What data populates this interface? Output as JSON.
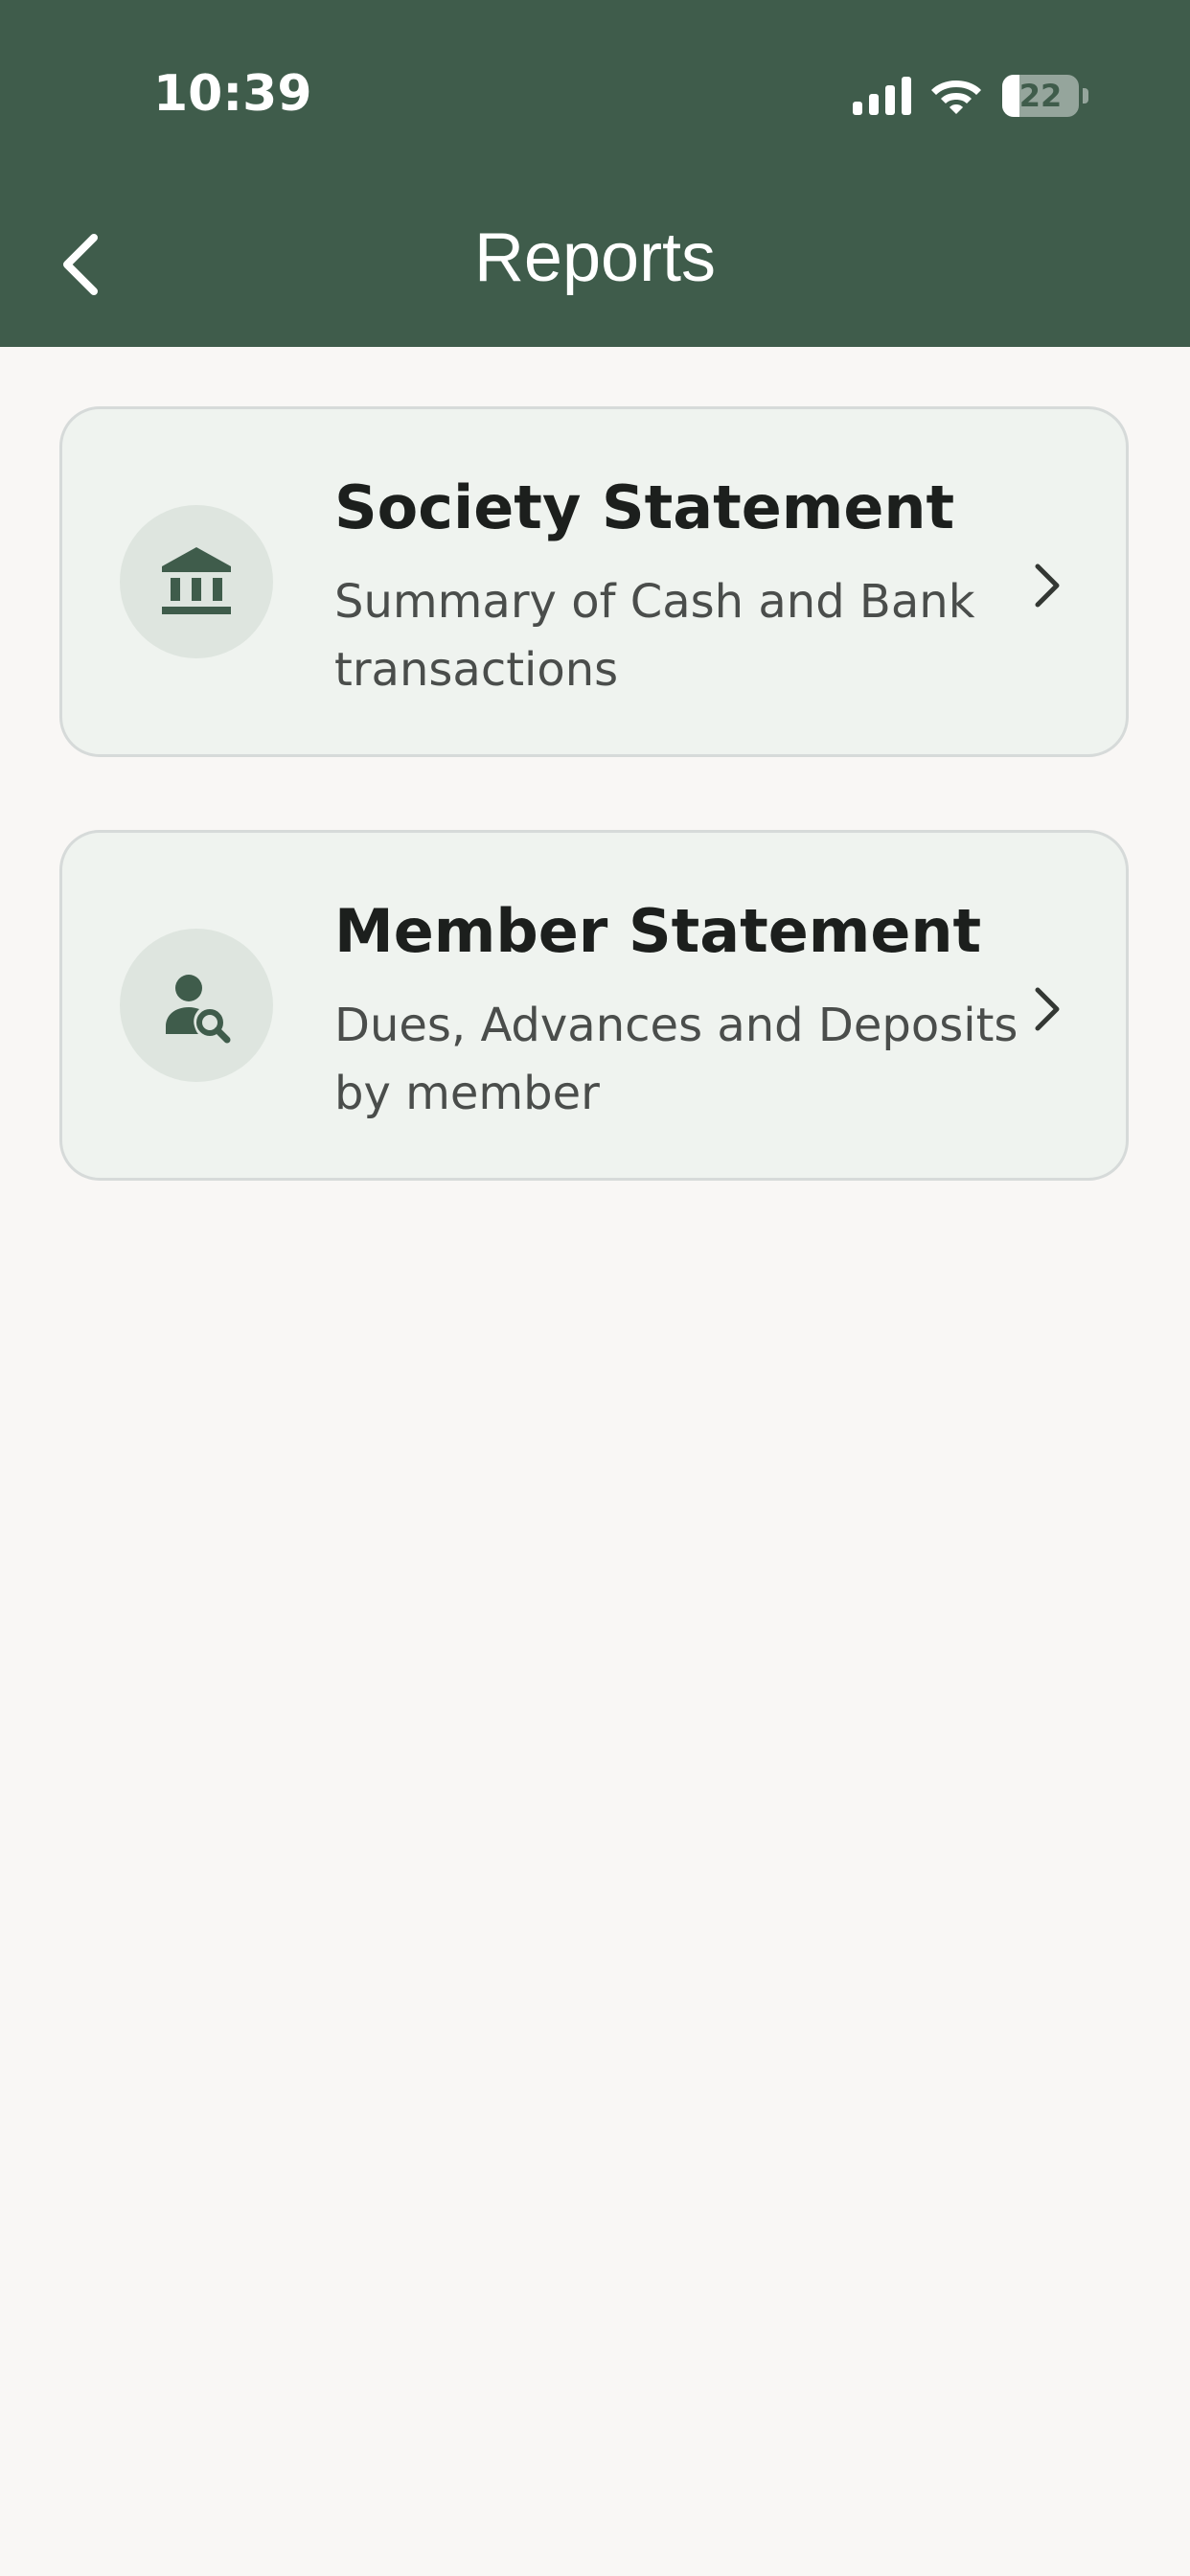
{
  "status_bar": {
    "time": "10:39",
    "battery_level": "22"
  },
  "header": {
    "title": "Reports",
    "back_icon": "chevron-left-icon"
  },
  "reports": [
    {
      "title": "Society Statement",
      "description": "Summary of Cash and Bank transactions",
      "icon": "bank-icon"
    },
    {
      "title": "Member Statement",
      "description": "Dues, Advances and Deposits by member",
      "icon": "person-search-icon"
    }
  ],
  "colors": {
    "header_bg": "#3f5c4b",
    "page_bg": "#f9f7f5",
    "card_bg": "#eff3ef",
    "icon_circle_bg": "#dee5df",
    "icon_fg": "#3f5c4b"
  }
}
